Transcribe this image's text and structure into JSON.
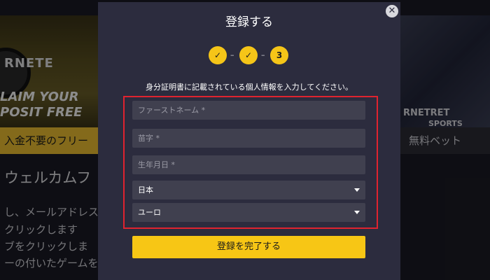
{
  "background": {
    "left_banner": {
      "brand": "RNETE",
      "promo_line1": "LAIM YOUR",
      "promo_line2": "POSIT FREE"
    },
    "left_tab_label": "入金不要のフリー",
    "right_banner": {
      "brand_line1": "RNETRET",
      "brand_line2": "SPORTS"
    },
    "right_tab_label": "無料ベット",
    "heading": "ウェルカムフ",
    "steps": [
      "し、メールアドレス",
      "クリックします",
      "ブをクリックしま",
      "ーの付いたゲームを"
    ]
  },
  "modal": {
    "title": "登録する",
    "close_icon": "close-icon",
    "steps": [
      {
        "label": "✓",
        "state": "complete"
      },
      {
        "label": "✓",
        "state": "complete"
      },
      {
        "label": "3",
        "state": "current"
      }
    ],
    "step_separator": "–",
    "instructions": "身分証明書に記載されている個人情報を入力してください。",
    "form": {
      "first_name_placeholder": "ファーストネーム *",
      "last_name_placeholder": "苗字 *",
      "birthdate_placeholder": "生年月日 *",
      "country_value": "日本",
      "currency_value": "ユーロ"
    },
    "submit_label": "登録を完了する"
  },
  "colors": {
    "accent": "#f5c518",
    "modal_bg": "#2c2c3e",
    "field_bg": "#40404f",
    "highlight": "#e0232f"
  }
}
